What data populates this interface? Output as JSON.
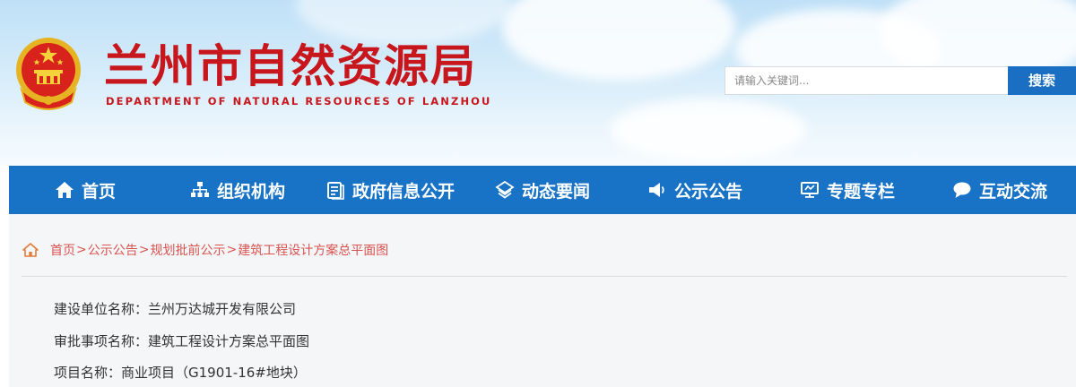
{
  "header": {
    "title": "兰州市自然资源局",
    "subtitle": "DEPARTMENT OF NATURAL RESOURCES OF LANZHOU",
    "emblem_icon": "national-emblem",
    "search_placeholder": "请输入关键词...",
    "search_button": "搜索"
  },
  "nav": {
    "items": [
      {
        "label": "首页",
        "icon": "home-icon"
      },
      {
        "label": "组织机构",
        "icon": "org-chart-icon"
      },
      {
        "label": "政府信息公开",
        "icon": "document-icon"
      },
      {
        "label": "动态要闻",
        "icon": "news-icon"
      },
      {
        "label": "公示公告",
        "icon": "megaphone-icon"
      },
      {
        "label": "专题专栏",
        "icon": "screen-icon"
      },
      {
        "label": "互动交流",
        "icon": "chat-icon"
      }
    ]
  },
  "breadcrumb": {
    "items": [
      "首页",
      "公示公告",
      "规划批前公示",
      "建筑工程设计方案总平面图"
    ],
    "separator": ">"
  },
  "details": {
    "row1": "建设单位名称：兰州万达城开发有限公司",
    "row2": "审批事项名称：建筑工程设计方案总平面图",
    "row3": "项目名称：商业项目（G1901-16#地块）"
  },
  "colors": {
    "brand_red": "#c8161d",
    "nav_blue": "#1873c6",
    "search_blue": "#1a6fc2",
    "breadcrumb_red": "#d9534f"
  }
}
